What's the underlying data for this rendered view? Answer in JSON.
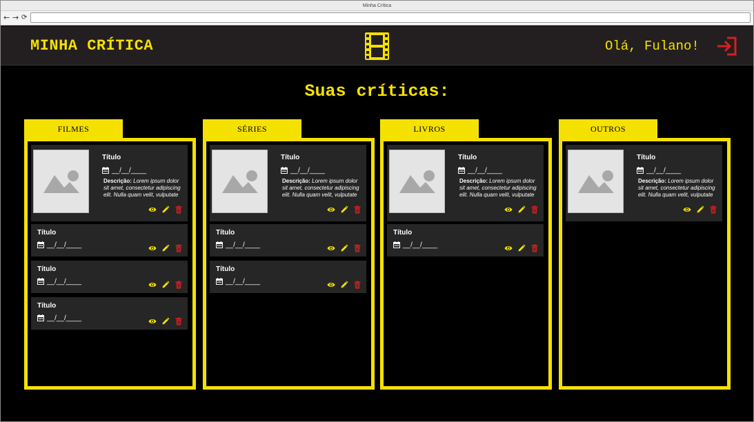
{
  "browser": {
    "window_title": "Minha Crítica",
    "back_glyph": "←",
    "forward_glyph": "→",
    "reload_glyph": "⟳",
    "url": ""
  },
  "header": {
    "brand": "MINHA CRÍTICA",
    "greeting": "Olá, Fulano!",
    "center_icon": "film-strip-icon",
    "logout_icon": "logout-icon"
  },
  "page": {
    "title": "Suas críticas:"
  },
  "colors": {
    "accent": "#f5e100",
    "danger": "#d42020",
    "background": "#000000",
    "card": "#262626",
    "header": "#231f20"
  },
  "columns": [
    {
      "label": "FILMES",
      "featured": {
        "title": "Título",
        "date": "__/__/____",
        "desc_label": "Descrição:",
        "desc_text": "Lorem ipsum dolor sit amet, consectetur adipiscing elit. Nulla quam velit, vulputate"
      },
      "items": [
        {
          "title": "Título",
          "date": "__/__/____"
        },
        {
          "title": "Título",
          "date": "__/__/____"
        },
        {
          "title": "Título",
          "date": "__/__/____"
        }
      ]
    },
    {
      "label": "SÉRIES",
      "featured": {
        "title": "Título",
        "date": "__/__/____",
        "desc_label": "Descrição:",
        "desc_text": "Lorem ipsum dolor sit amet, consectetur adipiscing elit. Nulla quam velit, vulputate"
      },
      "items": [
        {
          "title": "Título",
          "date": "__/__/____"
        },
        {
          "title": "Título",
          "date": "__/__/____"
        }
      ]
    },
    {
      "label": "LIVROS",
      "featured": {
        "title": "Título",
        "date": "__/__/____",
        "desc_label": "Descrição:",
        "desc_text": "Lorem ipsum dolor sit amet, consectetur adipiscing elit. Nulla quam velit, vulputate"
      },
      "items": [
        {
          "title": "Título",
          "date": "__/__/____"
        }
      ]
    },
    {
      "label": "OUTROS",
      "featured": {
        "title": "Título",
        "date": "__/__/____",
        "desc_label": "Descrição:",
        "desc_text": "Lorem ipsum dolor sit amet, consectetur adipiscing elit. Nulla quam velit, vulputate"
      },
      "items": []
    }
  ]
}
